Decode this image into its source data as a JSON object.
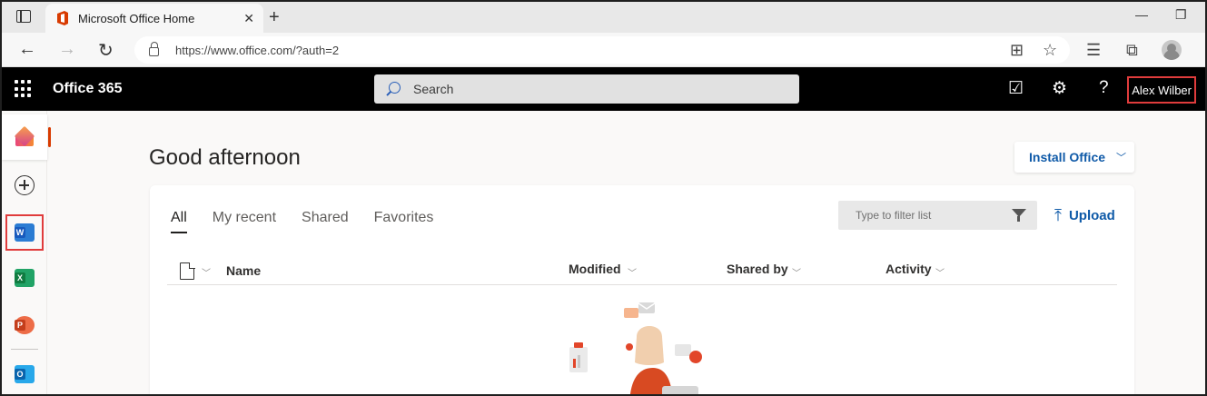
{
  "browser": {
    "tab_title": "Microsoft Office Home",
    "url": "https://www.office.com/?auth=2"
  },
  "header": {
    "brand": "Office 365",
    "search_placeholder": "Search",
    "user_name": "Alex Wilber"
  },
  "left_rail": {
    "items": [
      {
        "name": "Home",
        "icon": "home-icon"
      },
      {
        "name": "Create",
        "icon": "create-icon"
      },
      {
        "name": "Word",
        "icon": "word-icon",
        "letter": "W"
      },
      {
        "name": "Excel",
        "icon": "excel-icon",
        "letter": "X"
      },
      {
        "name": "PowerPoint",
        "icon": "powerpoint-icon",
        "letter": "P"
      },
      {
        "name": "Outlook",
        "icon": "outlook-icon",
        "letter": "O"
      }
    ]
  },
  "main": {
    "greeting": "Good afternoon",
    "install_label": "Install Office",
    "tabs": [
      {
        "label": "All",
        "active": true
      },
      {
        "label": "My recent",
        "active": false
      },
      {
        "label": "Shared",
        "active": false
      },
      {
        "label": "Favorites",
        "active": false
      }
    ],
    "filter_placeholder": "Type to filter list",
    "upload_label": "Upload",
    "columns": {
      "name": "Name",
      "modified": "Modified",
      "shared_by": "Shared by",
      "activity": "Activity"
    }
  },
  "colors": {
    "accent_blue": "#0f5aa8",
    "highlight_red": "#e03c3c",
    "header_black": "#000000"
  }
}
